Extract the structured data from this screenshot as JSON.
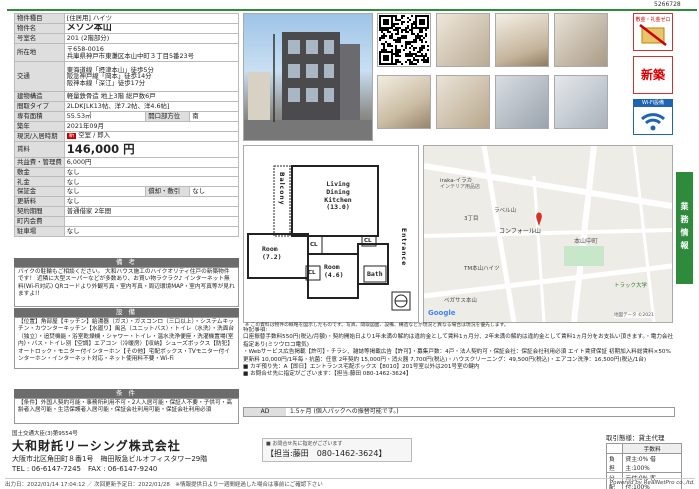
{
  "header": {
    "property_id": "5266728"
  },
  "property": {
    "rows": [
      {
        "label": "物件種目",
        "value": "[住居用] ハイツ"
      },
      {
        "label": "物件名",
        "value": "メゾン本山",
        "big": true
      },
      {
        "label": "号室名",
        "value": "201 (2階部分)"
      },
      {
        "label": "所在地",
        "lines": [
          "〒658-0016",
          "兵庫県神戸市東灘区本山中町３丁目5番23号"
        ]
      },
      {
        "label": "交通",
        "lines": [
          "東海道線「摂津本山」徒歩5分",
          "阪急神戸線「岡本」徒歩14分",
          "阪神本線「深江」徒歩17分"
        ]
      },
      {
        "label": "建物構造",
        "value": "軽量鉄骨造 地上3階 総戸数6戸"
      },
      {
        "label": "間取タイプ",
        "value": "2LDK[LK13帖、洋7.2帖、洋4.6帖]"
      },
      {
        "label": "専有面積",
        "value": "55.53㎡",
        "extra_label": "開口部方位",
        "extra_value": "南"
      },
      {
        "label": "築年",
        "value": "2021年09月"
      },
      {
        "label": "現況/入居時期",
        "value": "空室 / 即入",
        "badge": "新"
      },
      {
        "label": "賃料",
        "value": "146,000 円",
        "rent": true
      },
      {
        "label": "共益費・管理費",
        "value": "6,000円"
      },
      {
        "label": "敷金",
        "value": "なし"
      },
      {
        "label": "礼金",
        "value": "なし"
      },
      {
        "label": "保証金",
        "value": "なし",
        "extra_label": "償却・敷引",
        "extra_value": "なし"
      },
      {
        "label": "更新料",
        "value": "なし"
      },
      {
        "label": "契約期間",
        "value": "普通借家 2年間"
      },
      {
        "label": "町内会費",
        "value": ""
      },
      {
        "label": "駐車場",
        "value": "なし"
      }
    ]
  },
  "remarks": {
    "title": "備 考",
    "text": "バイクの駐輪もご相談ください。 大和ハウス施工のハイクオリティ住戸の新築物件です！ 近隣に大型スーパーなどが多数あり、お買い物ラクラク♪ インターネット無料(Wi-Fi対応) QRコードより外観写真・室内写真・周辺環境MAP・室内写真等が見れますよ!!"
  },
  "equipment": {
    "title": "設 備",
    "text": "【位置】角部屋【キッチン】給湯器（ガス）・ガスコンロ（三口以上）・システムキッチン・カウンターキッチン【水廻り】風呂（ユニットバス）・トイレ（水洗）・洗面台（独立）・追焚機能・浴室乾燥機・シャワー・トイレ・温水洗浄便座・洗濯機置場(室内)・バス・トイレ別【空調】エアコン（冷暖房）【収納】シューズボックス【防犯】オートロック・モニター付インターホン【その他】宅配ボックス・TVモニター付インターホン・インターネット対応・ネット使用料不要・Wi-Fi"
  },
  "conditions": {
    "title": "条 件",
    "text": "【条件】外国人契約可能・事務所利用不可・2人入居可能・保証人不要・子供可・高齢者入居可能・生活保護者入居可能・保証会社利用可能・保証会社利用必須"
  },
  "floorplan": {
    "rooms": {
      "ldk": "Living Dining Kitchen (13.0)",
      "room1": "Room (7.2)",
      "room2": "Room (4.6)",
      "bath": "Bath",
      "cl1": "CL",
      "cl2": "CL",
      "cl3": "CL",
      "balcony": "Balcony",
      "entrance": "Entrance"
    }
  },
  "map": {
    "labels": [
      "iraka-イラカ",
      "インテリア用品店",
      "ラベル山",
      "コンフォール山",
      "3丁目",
      "本山中町",
      "TM本山ハイツ",
      "トラック大学",
      "ペガサス本山"
    ],
    "brand": "Google",
    "credit": "地図データ ©2021",
    "caption": "※ この資料は物件の概略を図示したものです。写真、間取図面、設備、構造などが現況と異なる場合は現況を優先します。"
  },
  "features": {
    "box1": "敷金・礼金ゼロ",
    "box2": "新築",
    "box3": "Wi-Fi設備"
  },
  "side_button": "業務情報",
  "notes": {
    "title": "特記事項:",
    "lines": [
      "口座振替手数料550円(税込/月額)・契約開始日より1年未満の解約は違約金として賃料1ヵ月分、2年未満の解約は違約金として賃料1ヵ月分をお支払い頂きます。・電力会社指定あり(ミツウロコ電気)",
      "・Webサービス広告掲載【許可】・チラシ、雑誌等掲載広告【許可】・募集戸数：4戸・法人契約可・保証会社：保証会社利用必須 エイト賃貸保証 初期加入料総賃料×50% 更新料 10,000円/1年毎・抗菌：任意 2年契約 15,000円・消火器 7,700円(税込)・ハウスクリーニング：49,500円(税込)・エアコン洗浄：16,500円(税込/1台)",
      "■ カギ預り先：A【即日】エントランス宅配ボックス【8010】201号室以外は201号室の鍵内",
      "■ お問合せ先に指定がございます：【担当:藤田 080-1462-3624】"
    ]
  },
  "ad": {
    "label": "AD",
    "value": "1.5ヶ月 (個人パックへの振替可能です。)"
  },
  "agent": {
    "license": "国土交通大臣(3)第9554号",
    "name": "大和財託リーシング株式会社",
    "address": "大阪市北区角田町８番1号　梅田阪急ビルオフィスタワー29階",
    "phone": "TEL : 06-6147-7245　FAX : 06-6147-9240"
  },
  "contact": {
    "note": "■ お問合せ先に指定がございます",
    "text": "【担当:藤田　080-1462-3624】"
  },
  "fees": {
    "title": "取引態様：貸主代理",
    "header": "手数料",
    "rows": [
      {
        "label": "負担",
        "value": "貸主:0% 借主:100%"
      },
      {
        "label": "分配",
        "value": "元付:0% 客付:100%"
      }
    ]
  },
  "footer": {
    "left": "出力日：2022/01/14 17:04:12 ／ 次回更新予定日：2022/01/28　※情報提供日より一週間経過した場合は事前にご確認下さい",
    "right": "Powered by RealNetPro co.,ltd."
  }
}
